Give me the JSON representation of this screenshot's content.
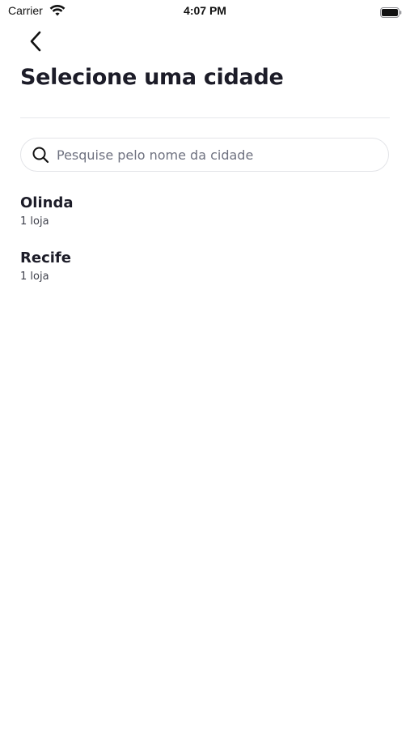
{
  "status_bar": {
    "carrier": "Carrier",
    "time": "4:07 PM",
    "wifi_icon": "wifi-icon",
    "battery_icon": "battery-icon"
  },
  "header": {
    "back_icon": "chevron-left-icon",
    "title": "Selecione uma cidade"
  },
  "search": {
    "icon": "search-icon",
    "placeholder": "Pesquise pelo nome da cidade",
    "value": ""
  },
  "cities": [
    {
      "name": "Olinda",
      "stores": "1 loja"
    },
    {
      "name": "Recife",
      "stores": "1 loja"
    }
  ],
  "colors": {
    "text_primary": "#1c1c28",
    "text_secondary": "#3d3f4a",
    "placeholder": "#6f7280",
    "border": "#e3e4e8",
    "background": "#ffffff"
  }
}
